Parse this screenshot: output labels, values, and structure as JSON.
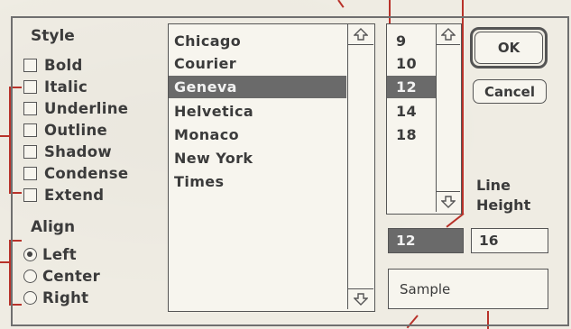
{
  "style_group": {
    "heading": "Style",
    "options": [
      {
        "label": "Bold",
        "checked": false
      },
      {
        "label": "Italic",
        "checked": false
      },
      {
        "label": "Underline",
        "checked": false
      },
      {
        "label": "Outline",
        "checked": false
      },
      {
        "label": "Shadow",
        "checked": false
      },
      {
        "label": "Condense",
        "checked": false
      },
      {
        "label": "Extend",
        "checked": false
      }
    ]
  },
  "align_group": {
    "heading": "Align",
    "options": [
      {
        "label": "Left",
        "selected": true
      },
      {
        "label": "Center",
        "selected": false
      },
      {
        "label": "Right",
        "selected": false
      }
    ]
  },
  "font_list": {
    "items": [
      "Chicago",
      "Courier",
      "Geneva",
      "Helvetica",
      "Monaco",
      "New York",
      "Times"
    ],
    "selected": "Geneva"
  },
  "size_list": {
    "items": [
      "9",
      "10",
      "12",
      "14",
      "18"
    ],
    "selected": "12"
  },
  "size_field": {
    "value": "12"
  },
  "line_height": {
    "label_line1": "Line",
    "label_line2": "Height",
    "value": "16"
  },
  "sample_box": {
    "text": "Sample"
  },
  "buttons": {
    "ok": "OK",
    "cancel": "Cancel"
  },
  "colors": {
    "callout": "#b8322a",
    "selection": "#6a6a6a"
  }
}
